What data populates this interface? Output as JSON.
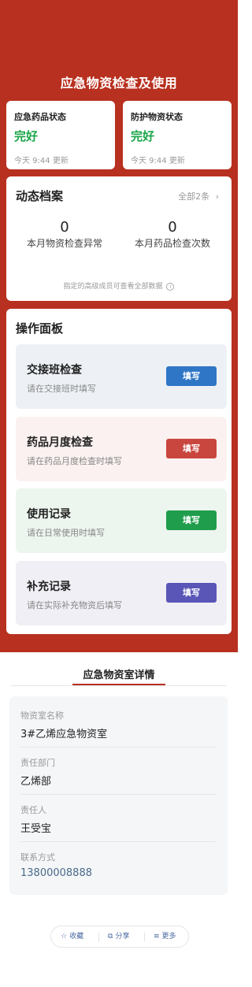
{
  "page": {
    "title": "应急物资检查及使用"
  },
  "status_cards": [
    {
      "title": "应急药品状态",
      "value": "完好",
      "updated": "今天 9:44 更新"
    },
    {
      "title": "防护物资状态",
      "value": "完好",
      "updated": "今天 9:44 更新"
    }
  ],
  "archive": {
    "title": "动态档案",
    "link": "全部2条",
    "link_icon": "›",
    "stats": [
      {
        "value": "0",
        "label": "本月物资检查异常"
      },
      {
        "value": "0",
        "label": "本月药品检查次数"
      }
    ],
    "note": "指定的高级成员可查看全部数据",
    "note_icon": "i"
  },
  "panel": {
    "title": "操作面板",
    "items": [
      {
        "title": "交接班检查",
        "subtitle": "请在交接班时填写",
        "button": "填写",
        "bg": "#edf1f6",
        "btn_color": "#2f76c6"
      },
      {
        "title": "药品月度检查",
        "subtitle": "请在药品月度检查时填写",
        "button": "填写",
        "bg": "#faf1f0",
        "btn_color": "#c9463e"
      },
      {
        "title": "使用记录",
        "subtitle": "请在日常使用时填写",
        "button": "填写",
        "bg": "#edf5ef",
        "btn_color": "#1f9d4c"
      },
      {
        "title": "补充记录",
        "subtitle": "请在实际补充物资后填写",
        "button": "填写",
        "bg": "#efeff5",
        "btn_color": "#5a56b8"
      }
    ]
  },
  "detail": {
    "tab": "应急物资室详情",
    "fields": [
      {
        "label": "物资室名称",
        "value": "3#乙烯应急物资室"
      },
      {
        "label": "责任部门",
        "value": "乙烯部"
      },
      {
        "label": "责任人",
        "value": "王受宝"
      },
      {
        "label": "联系方式",
        "value": "13800008888"
      }
    ]
  },
  "actions": [
    {
      "label": "收藏",
      "icon": "☆"
    },
    {
      "label": "分享",
      "icon": "⧉"
    },
    {
      "label": "更多",
      "icon": "≡"
    }
  ],
  "colors": {
    "brand": "#b8301f",
    "ok": "#1aa548"
  }
}
